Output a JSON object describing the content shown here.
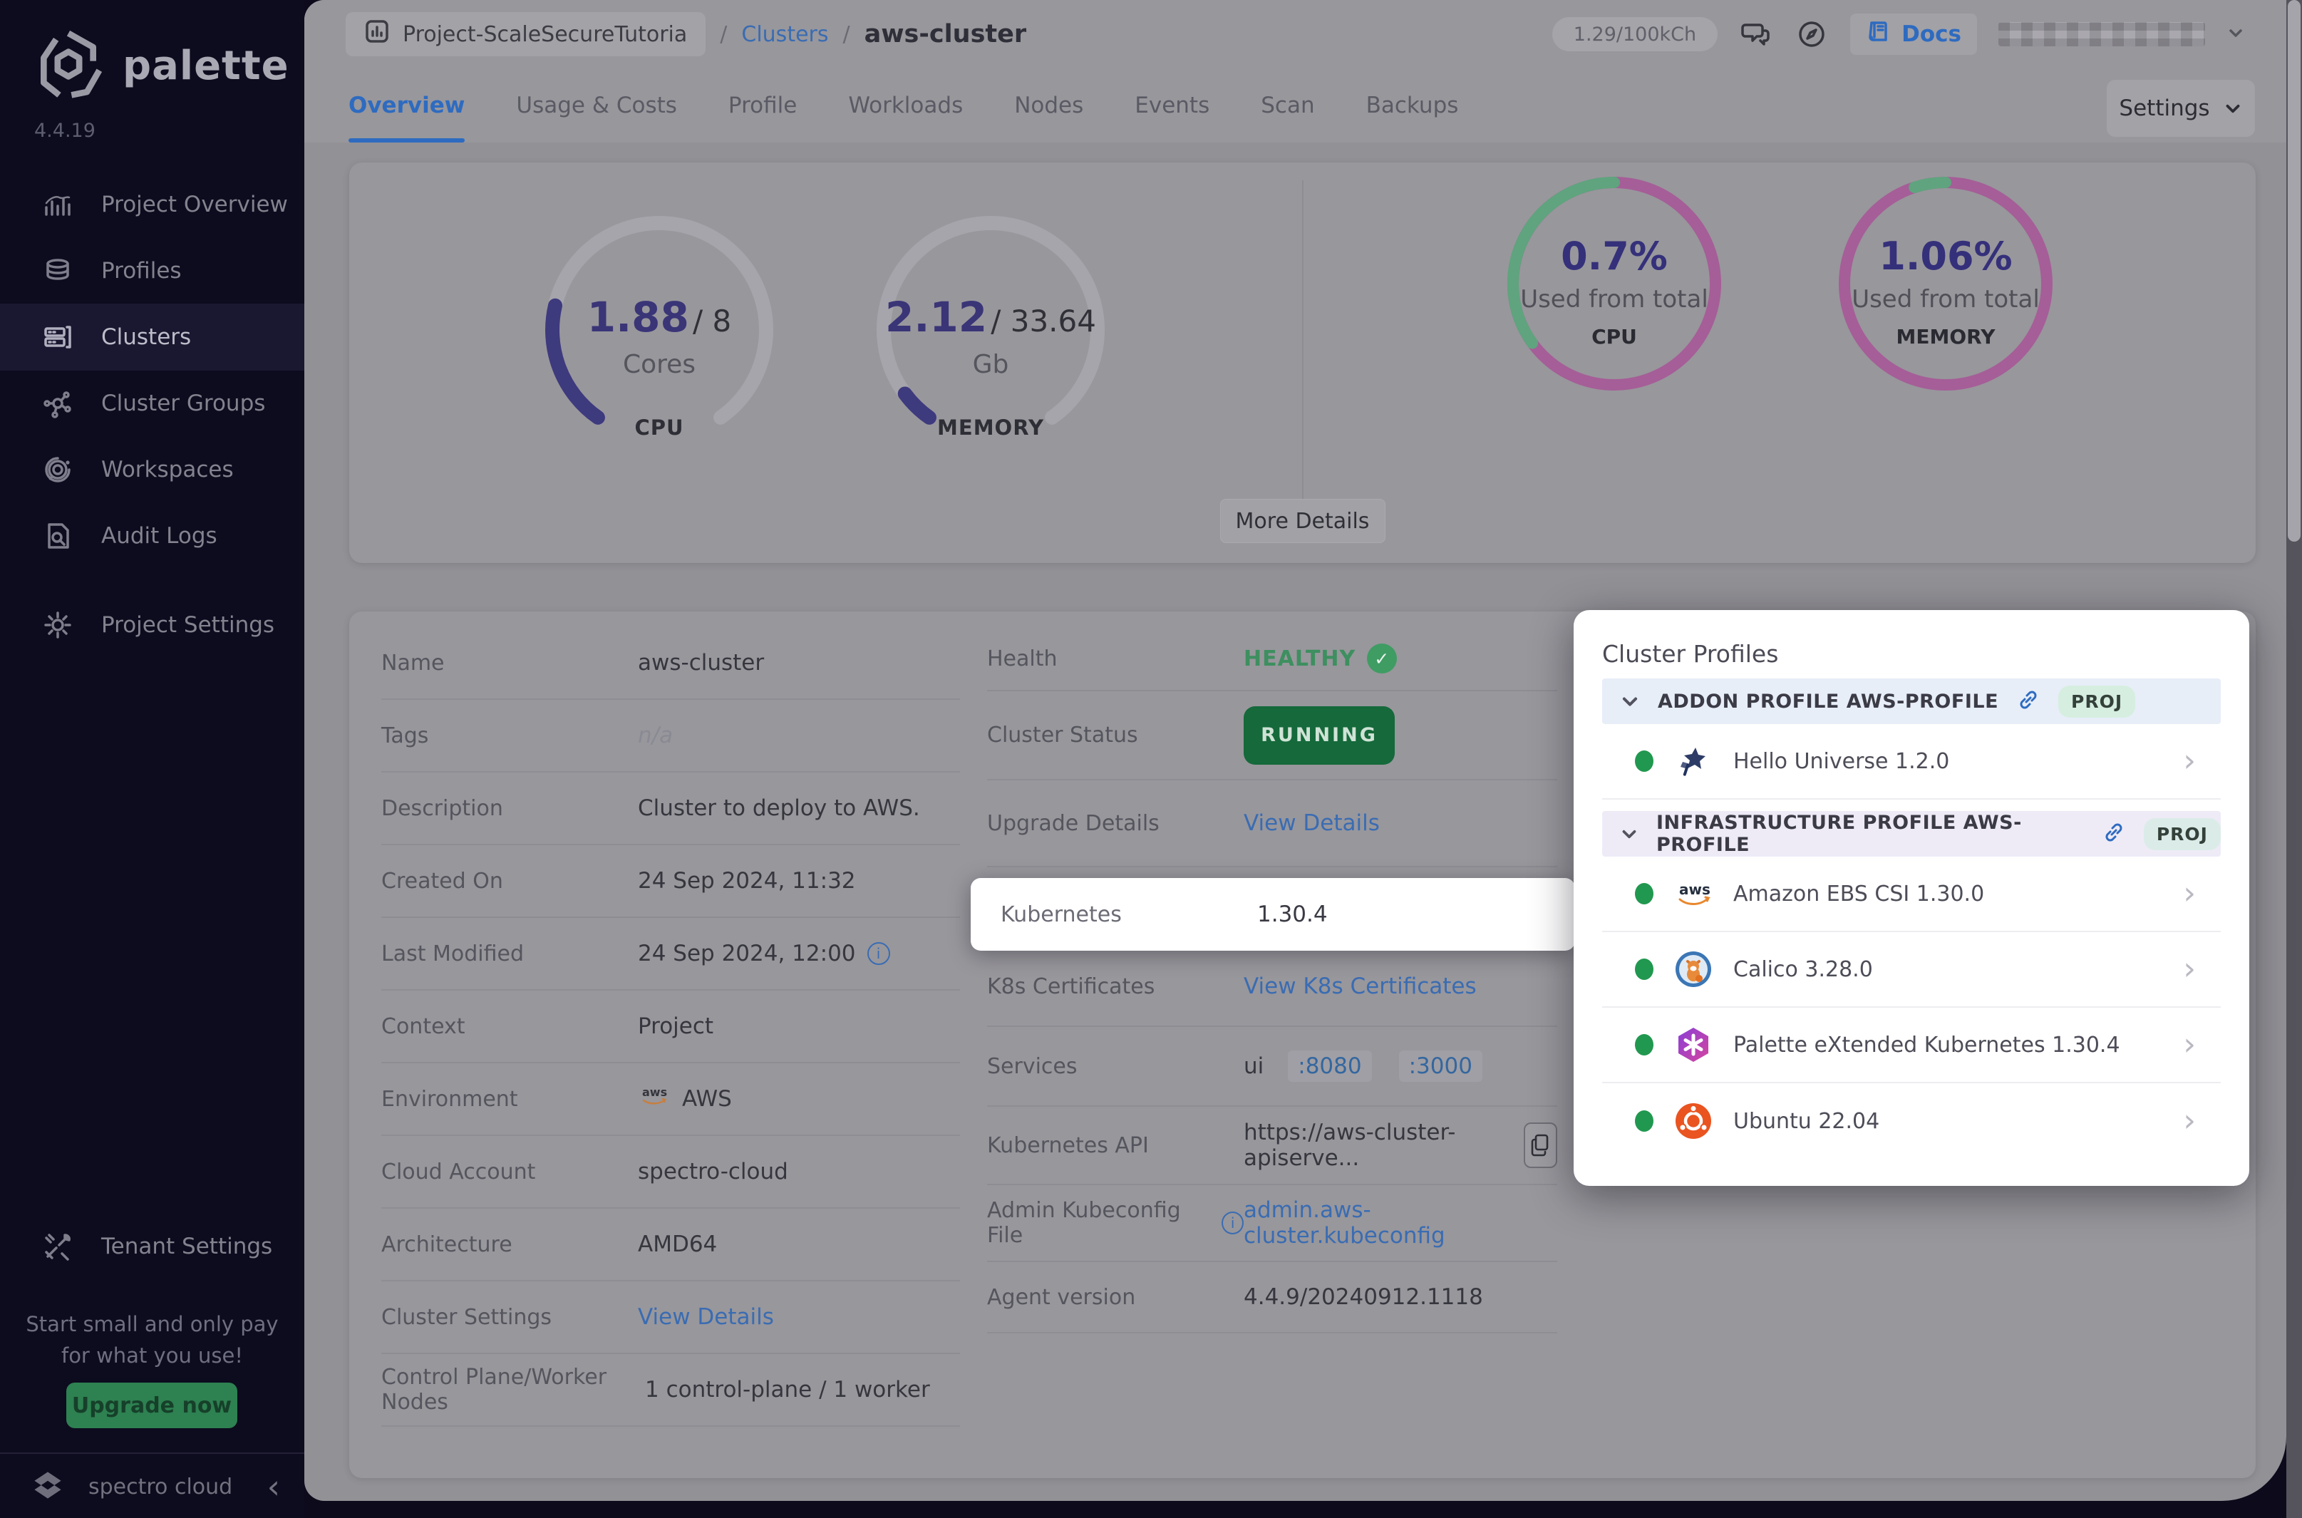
{
  "colors": {
    "accent_blue": "#2f6fd3",
    "healthy_green": "#3d8f5f",
    "running_green": "#15693a",
    "gauge_purple": "#3e3a7e",
    "donut_magenta": "#a55e97",
    "donut_green": "#5fa47e",
    "brand_dark": "#0d0b1e",
    "upgrade_green": "#2e8151",
    "spotlight_white": "#ffffff"
  },
  "sidebar": {
    "brand": "palette",
    "version": "4.4.19",
    "items": [
      {
        "label": "Project Overview",
        "icon": "bar-chart-icon",
        "selected": false
      },
      {
        "label": "Profiles",
        "icon": "layers-icon",
        "selected": false
      },
      {
        "label": "Clusters",
        "icon": "clusters-icon",
        "selected": true
      },
      {
        "label": "Cluster Groups",
        "icon": "cluster-groups-icon",
        "selected": false
      },
      {
        "label": "Workspaces",
        "icon": "workspaces-icon",
        "selected": false
      },
      {
        "label": "Audit Logs",
        "icon": "audit-logs-icon",
        "selected": false
      },
      {
        "label": "Project Settings",
        "icon": "gear-icon",
        "selected": false
      }
    ],
    "tenant_settings": "Tenant Settings",
    "promo": {
      "line1": "Start small and only pay",
      "line2": "for what you use!",
      "button": "Upgrade now"
    },
    "footer": {
      "brand": "spectro cloud"
    }
  },
  "header": {
    "project": "Project-ScaleSecureTutoria",
    "separator": "/",
    "clusters_link": "Clusters",
    "current": "aws-cluster",
    "usage": "1.29/100kCh",
    "docs": "Docs"
  },
  "tabs": {
    "items": [
      "Overview",
      "Usage & Costs",
      "Profile",
      "Workloads",
      "Nodes",
      "Events",
      "Scan",
      "Backups"
    ],
    "active": "Overview",
    "settings_button": "Settings"
  },
  "metrics": {
    "cpu_gauge": {
      "value": "1.88",
      "total": "/ 8",
      "unit": "Cores",
      "label": "CPU",
      "fraction": 0.235
    },
    "memory_gauge": {
      "value": "2.12",
      "total": "/ 33.64",
      "unit": "Gb",
      "label": "MEMORY",
      "fraction": 0.063
    },
    "cpu_donut": {
      "percent": "0.7%",
      "caption": "Used from total",
      "label": "CPU",
      "green_fraction": 0.35
    },
    "memory_donut": {
      "percent": "1.06%",
      "caption": "Used from total",
      "label": "MEMORY",
      "green_fraction": 0.05
    },
    "more_details": "More Details"
  },
  "details": {
    "left": [
      {
        "label": "Name",
        "value": "aws-cluster"
      },
      {
        "label": "Tags",
        "value": "n/a"
      },
      {
        "label": "Description",
        "value": "Cluster to deploy to AWS."
      },
      {
        "label": "Created On",
        "value": "24 Sep 2024, 11:32"
      },
      {
        "label": "Last Modified",
        "value": "24 Sep 2024, 12:00"
      },
      {
        "label": "Context",
        "value": "Project"
      },
      {
        "label": "Environment",
        "value": "AWS"
      },
      {
        "label": "Cloud Account",
        "value": "spectro-cloud"
      },
      {
        "label": "Architecture",
        "value": "AMD64"
      },
      {
        "label": "Cluster Settings",
        "value": "View Details"
      },
      {
        "label": "Control Plane/Worker Nodes",
        "value": "1 control-plane / 1 worker"
      }
    ],
    "right": {
      "health_label": "Health",
      "health_value": "HEALTHY",
      "status_label": "Cluster Status",
      "status_value": "RUNNING",
      "upgrade_label": "Upgrade Details",
      "upgrade_value": "View Details",
      "kubernetes_label": "Kubernetes",
      "kubernetes_value": "1.30.4",
      "certs_label": "K8s Certificates",
      "certs_value": "View K8s Certificates",
      "services_label": "Services",
      "services_prefix": "ui",
      "services_ports": [
        ":8080",
        ":3000"
      ],
      "api_label": "Kubernetes API",
      "api_value": "https://aws-cluster-apiserve...",
      "kubeconfig_label": "Admin Kubeconfig File",
      "kubeconfig_value": "admin.aws-cluster.kubeconfig",
      "agent_label": "Agent version",
      "agent_value": "4.4.9/20240912.1118"
    }
  },
  "cluster_profiles": {
    "title": "Cluster Profiles",
    "sections": [
      {
        "header": "ADDON PROFILE AWS-PROFILE",
        "badge": "PROJ",
        "items": [
          {
            "name": "Hello Universe 1.2.0",
            "icon": "hello-universe-icon"
          }
        ]
      },
      {
        "header": "INFRASTRUCTURE PROFILE AWS-PROFILE",
        "badge": "PROJ",
        "items": [
          {
            "name": "Amazon EBS CSI 1.30.0",
            "icon": "aws-icon"
          },
          {
            "name": "Calico 3.28.0",
            "icon": "calico-icon"
          },
          {
            "name": "Palette eXtended Kubernetes 1.30.4",
            "icon": "pxk-icon"
          },
          {
            "name": "Ubuntu 22.04",
            "icon": "ubuntu-icon"
          }
        ]
      }
    ]
  }
}
